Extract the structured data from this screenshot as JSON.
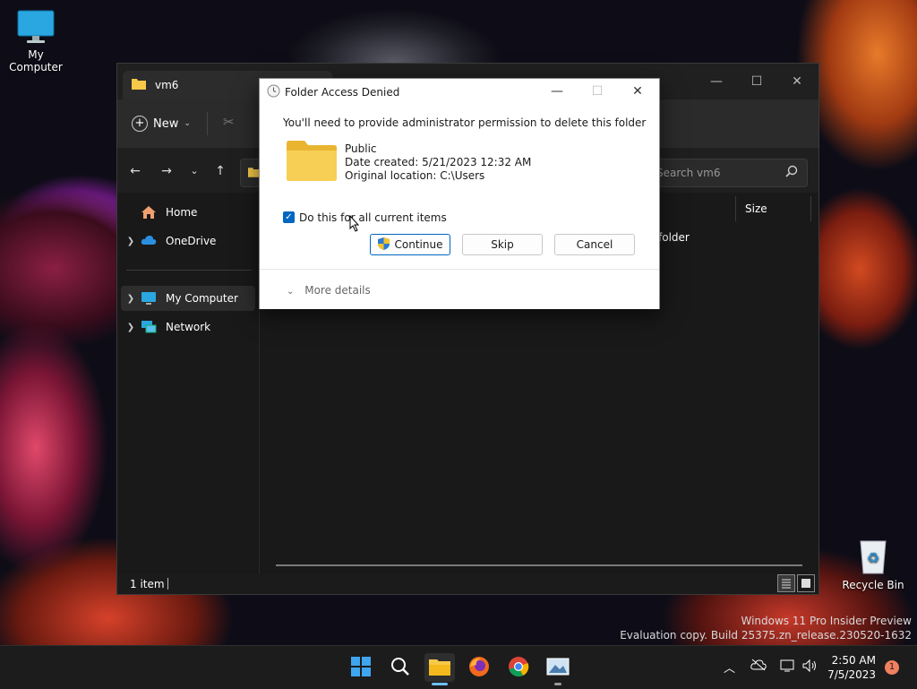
{
  "desktop": {
    "my_computer_label": "My Computer",
    "recycle_bin_label": "Recycle Bin",
    "watermark_line1": "Windows 11 Pro Insider Preview",
    "watermark_line2": "Evaluation copy. Build 25375.zn_release.230520-1632"
  },
  "explorer": {
    "tab_title": "vm6",
    "new_button": "New",
    "search_placeholder": "Search vm6",
    "sidebar": {
      "home": "Home",
      "onedrive": "OneDrive",
      "my_computer": "My Computer",
      "network": "Network"
    },
    "column_size": "Size",
    "row_type": "folder",
    "status_text": "1 item"
  },
  "dialog": {
    "title": "Folder Access Denied",
    "message": "You'll need to provide administrator permission to delete this folder",
    "folder_name": "Public",
    "date_created": "Date created: 5/21/2023 12:32 AM",
    "original_location": "Original location: C:\\Users",
    "checkbox_label": "Do this for all current items",
    "checkbox_checked": true,
    "continue_label": "Continue",
    "skip_label": "Skip",
    "cancel_label": "Cancel",
    "more_details": "More details"
  },
  "taskbar": {
    "time": "2:50 AM",
    "date": "7/5/2023",
    "notification_count": "1"
  },
  "colors": {
    "accent": "#0067c0",
    "folder_yellow": "#f7c948"
  }
}
